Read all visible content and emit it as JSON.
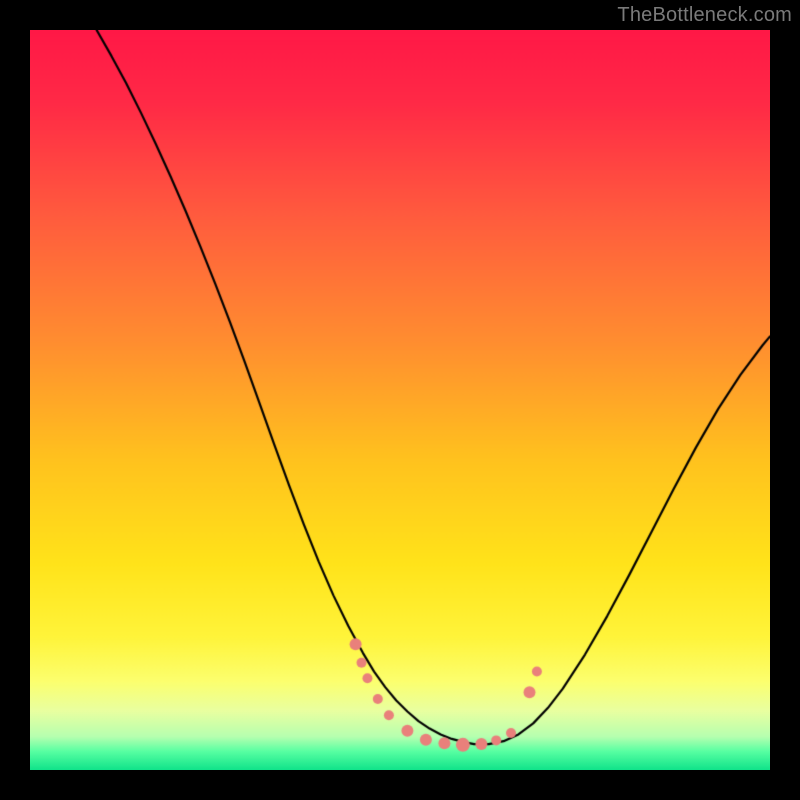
{
  "watermark": {
    "text": "TheBottleneck.com"
  },
  "chart_data": {
    "type": "line",
    "title": "",
    "xlabel": "",
    "ylabel": "",
    "xlim": [
      0,
      100
    ],
    "ylim": [
      0,
      100
    ],
    "grid": false,
    "legend": false,
    "background_gradient": {
      "stops": [
        {
          "pos": 0.0,
          "color": "#ff1846"
        },
        {
          "pos": 0.1,
          "color": "#ff2a46"
        },
        {
          "pos": 0.25,
          "color": "#ff5b3e"
        },
        {
          "pos": 0.42,
          "color": "#ff8d30"
        },
        {
          "pos": 0.58,
          "color": "#ffc21e"
        },
        {
          "pos": 0.72,
          "color": "#ffe31a"
        },
        {
          "pos": 0.82,
          "color": "#fff43a"
        },
        {
          "pos": 0.88,
          "color": "#fcff6e"
        },
        {
          "pos": 0.92,
          "color": "#e9ffa0"
        },
        {
          "pos": 0.955,
          "color": "#b6ffb0"
        },
        {
          "pos": 0.975,
          "color": "#57ffa2"
        },
        {
          "pos": 1.0,
          "color": "#10e38a"
        }
      ]
    },
    "series": [
      {
        "name": "bottleneck-curve",
        "color": "#000000",
        "width": 2.2,
        "x": [
          9,
          11,
          13,
          15,
          17,
          19,
          21,
          23,
          25,
          27,
          29,
          31,
          33,
          35,
          37,
          39,
          41,
          43,
          45,
          46.5,
          48,
          49.5,
          51,
          52.5,
          54,
          55.5,
          57,
          58.5,
          60,
          62,
          64,
          66,
          68,
          70,
          72,
          75,
          78,
          81,
          84,
          87,
          90,
          93,
          96,
          99,
          100
        ],
        "y": [
          100,
          96.5,
          92.8,
          88.8,
          84.6,
          80.2,
          75.6,
          70.8,
          65.8,
          60.6,
          55.2,
          49.6,
          44,
          38.5,
          33.2,
          28.2,
          23.6,
          19.5,
          15.8,
          13.3,
          11.2,
          9.4,
          7.9,
          6.6,
          5.6,
          4.8,
          4.2,
          3.8,
          3.5,
          3.5,
          3.9,
          4.8,
          6.3,
          8.4,
          11,
          15.6,
          20.8,
          26.4,
          32.2,
          38.0,
          43.6,
          48.8,
          53.4,
          57.4,
          58.6
        ]
      }
    ],
    "points": {
      "name": "bottleneck-markers",
      "color": "#e9807b",
      "radius_range": [
        4,
        8
      ],
      "data": [
        {
          "x": 44.0,
          "y": 17.0,
          "r": 6
        },
        {
          "x": 44.8,
          "y": 14.5,
          "r": 5
        },
        {
          "x": 45.6,
          "y": 12.4,
          "r": 5
        },
        {
          "x": 47.0,
          "y": 9.6,
          "r": 5
        },
        {
          "x": 48.5,
          "y": 7.4,
          "r": 5
        },
        {
          "x": 51.0,
          "y": 5.3,
          "r": 6
        },
        {
          "x": 53.5,
          "y": 4.1,
          "r": 6
        },
        {
          "x": 56.0,
          "y": 3.6,
          "r": 6
        },
        {
          "x": 58.5,
          "y": 3.4,
          "r": 7
        },
        {
          "x": 61.0,
          "y": 3.5,
          "r": 6
        },
        {
          "x": 63.0,
          "y": 4.0,
          "r": 5
        },
        {
          "x": 65.0,
          "y": 5.0,
          "r": 5
        },
        {
          "x": 67.5,
          "y": 10.5,
          "r": 6
        },
        {
          "x": 68.5,
          "y": 13.3,
          "r": 5
        }
      ]
    }
  }
}
